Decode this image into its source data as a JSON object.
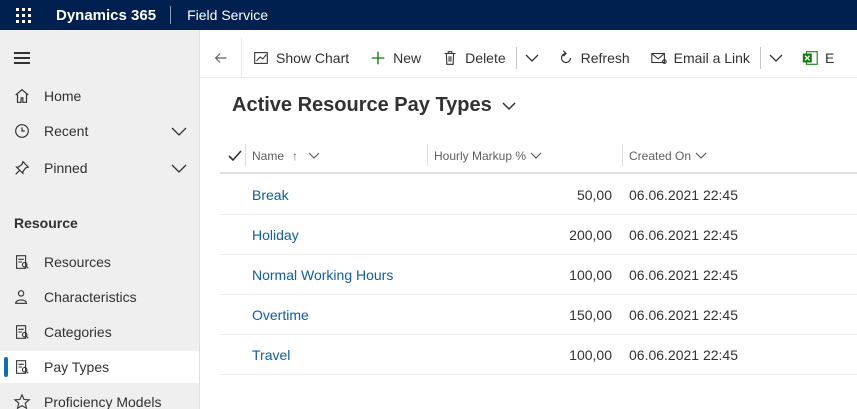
{
  "topbar": {
    "app_title": "Dynamics 365",
    "app_name": "Field Service"
  },
  "sidebar": {
    "items": [
      {
        "label": "Home",
        "icon": "home-icon"
      },
      {
        "label": "Recent",
        "icon": "clock-icon"
      },
      {
        "label": "Pinned",
        "icon": "pin-icon"
      }
    ],
    "section_title": "Resource",
    "section_items": [
      {
        "label": "Resources",
        "icon": "resource-icon"
      },
      {
        "label": "Characteristics",
        "icon": "person-icon"
      },
      {
        "label": "Categories",
        "icon": "category-icon"
      },
      {
        "label": "Pay Types",
        "icon": "paytype-icon",
        "selected": true
      },
      {
        "label": "Proficiency Models",
        "icon": "star-icon"
      }
    ]
  },
  "commandbar": {
    "show_chart": "Show Chart",
    "new": "New",
    "delete": "Delete",
    "refresh": "Refresh",
    "email_link": "Email a Link",
    "excel_partial": "E"
  },
  "view": {
    "title": "Active Resource Pay Types"
  },
  "grid": {
    "headers": {
      "name": "Name",
      "sort_indicator": "↑",
      "hourly_markup": "Hourly Markup %",
      "created_on": "Created On"
    },
    "rows": [
      {
        "name": "Break",
        "markup": "50,00",
        "created": "06.06.2021 22:45"
      },
      {
        "name": "Holiday",
        "markup": "200,00",
        "created": "06.06.2021 22:45"
      },
      {
        "name": "Normal Working Hours",
        "markup": "100,00",
        "created": "06.06.2021 22:45"
      },
      {
        "name": "Overtime",
        "markup": "150,00",
        "created": "06.06.2021 22:45"
      },
      {
        "name": "Travel",
        "markup": "100,00",
        "created": "06.06.2021 22:45"
      }
    ]
  },
  "colors": {
    "topbar": "#002050",
    "link": "#115ea3",
    "selection_bar": "#0f6cbd",
    "sidebar_bg": "#efefef"
  }
}
